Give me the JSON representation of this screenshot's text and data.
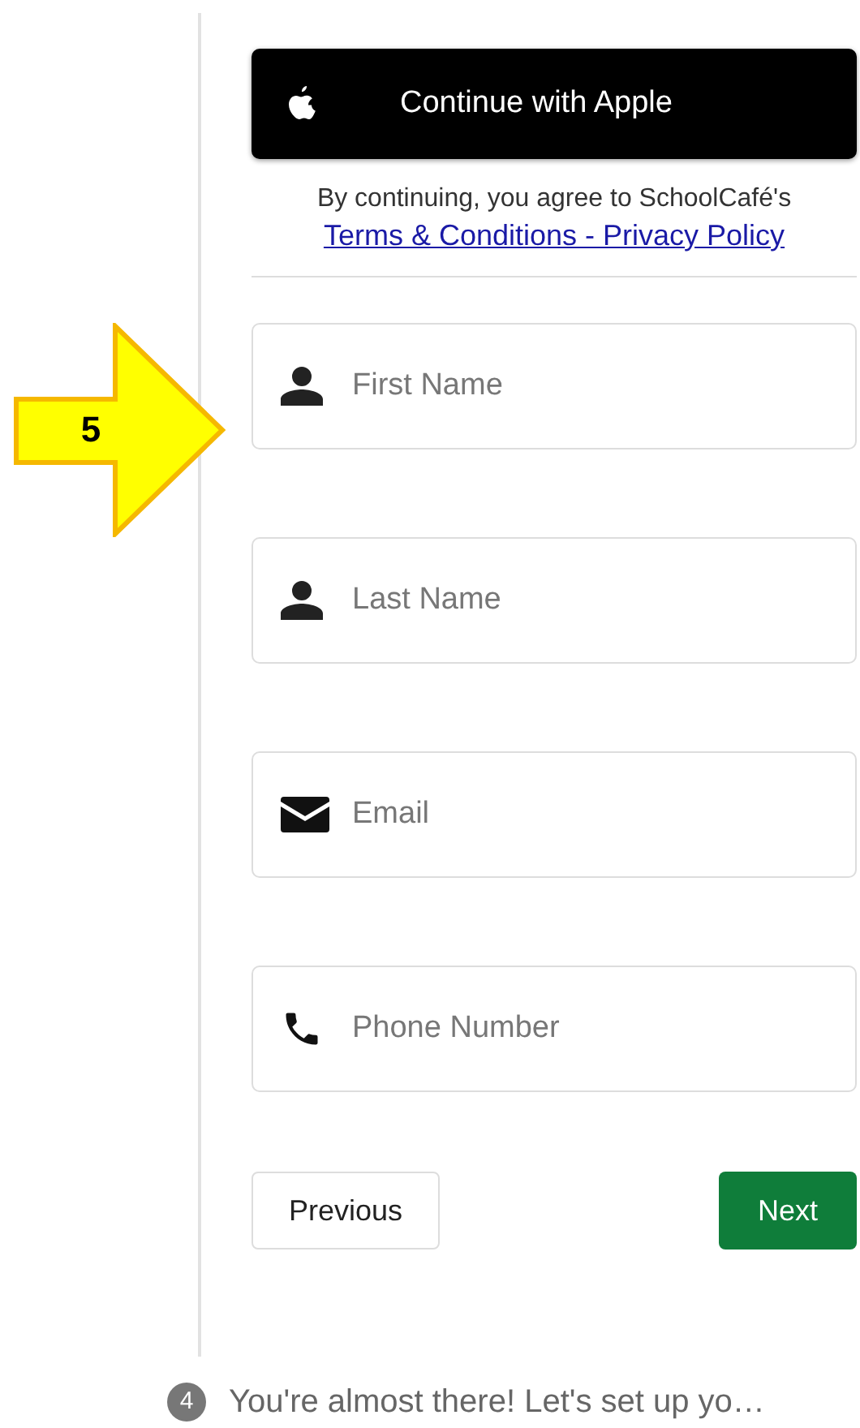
{
  "callout": {
    "label": "5"
  },
  "apple_button": {
    "label": "Continue with Apple"
  },
  "consent": {
    "text": "By continuing, you agree to SchoolCafé's",
    "link": "Terms & Conditions - Privacy Policy"
  },
  "fields": [
    {
      "kind": "person",
      "placeholder": "First Name"
    },
    {
      "kind": "person",
      "placeholder": "Last Name"
    },
    {
      "kind": "email",
      "placeholder": "Email"
    },
    {
      "kind": "phone",
      "placeholder": "Phone Number"
    }
  ],
  "buttons": {
    "previous": "Previous",
    "next": "Next"
  },
  "next_step": {
    "number": "4",
    "text": "You're almost there! Let's set up yo…"
  }
}
